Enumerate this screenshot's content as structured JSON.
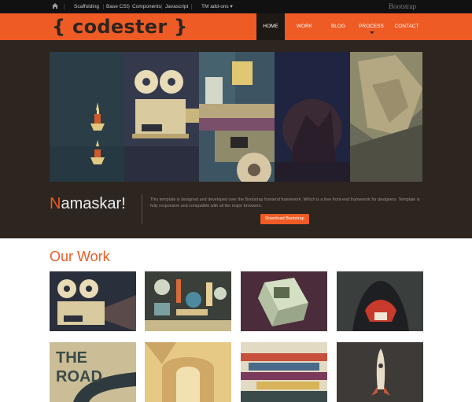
{
  "topbar": {
    "items": [
      "Scaffolding",
      "Base CSS",
      "Components",
      "Javascript",
      "TM add-ons ▾"
    ],
    "brand": "Bootstrap",
    "home_icon": "home-icon"
  },
  "header": {
    "logo": "{ codester }",
    "nav": [
      {
        "label": "HOME",
        "active": true
      },
      {
        "label": "WORK",
        "active": false
      },
      {
        "label": "BLOG",
        "active": false
      },
      {
        "label": "PROCESS",
        "active": false
      },
      {
        "label": "CONTACT",
        "active": false
      }
    ],
    "process_indicator_icon": "caret-down-icon"
  },
  "hero": {
    "greeting_first": "N",
    "greeting_rest": "amaskar!",
    "intro": "This template is designed and developed over the Bootstrap frontend framework. Which is a free front-end framework for designers. Template is fully responsive and compatible with all the major browsers.",
    "button": "Download Bootstrap"
  },
  "work": {
    "title": "Our Work"
  },
  "colors": {
    "accent": "#ee5b25",
    "dark": "#2c2520",
    "topbar": "#111111"
  }
}
